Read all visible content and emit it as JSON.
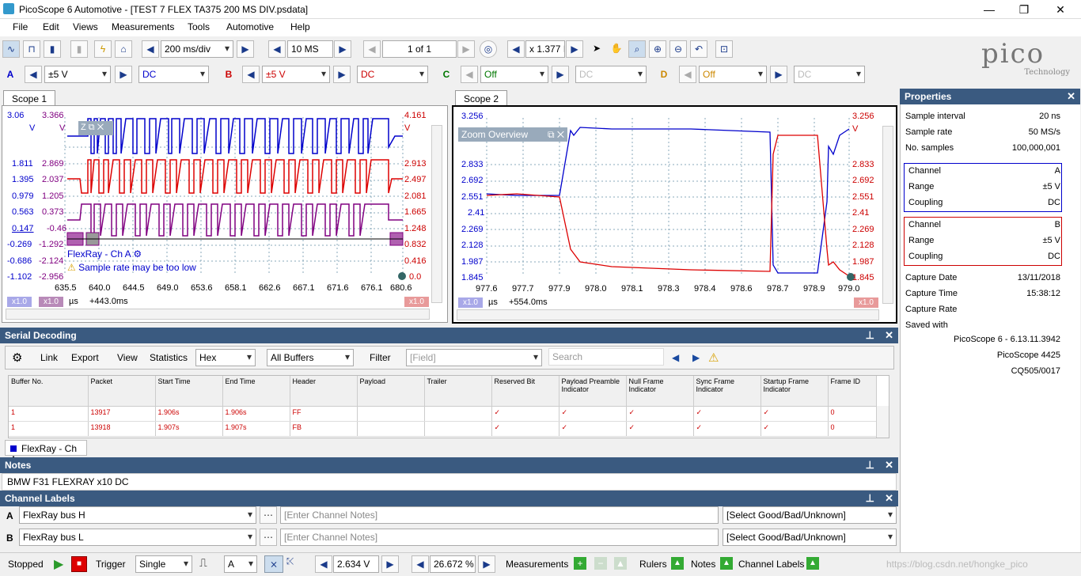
{
  "window": {
    "title": "PicoScope 6 Automotive - [TEST 7  FLEX TA375 200 MS DIV.psdata]",
    "min": "—",
    "max": "❐",
    "close": "✕"
  },
  "menu": [
    "File",
    "Edit",
    "Views",
    "Measurements",
    "Tools",
    "Automotive",
    "Help"
  ],
  "toolbar": {
    "timebase": "200 ms/div",
    "samples": "10 MS",
    "buffer": "1 of 1",
    "zoom": "x 1.377 I"
  },
  "channels": {
    "a": {
      "label": "A",
      "range": "±5 V",
      "coupling": "DC",
      "color": "#0000cc"
    },
    "b": {
      "label": "B",
      "range": "±5 V",
      "coupling": "DC",
      "color": "#cc0000"
    },
    "c": {
      "label": "C",
      "range": "Off",
      "coupling": "DC",
      "color": "#007700"
    },
    "d": {
      "label": "D",
      "range": "Off",
      "coupling": "DC",
      "color": "#cc8800"
    }
  },
  "logo": {
    "text": "pico",
    "sub": "Technology"
  },
  "scope1": {
    "tab": "Scope 1",
    "ylabels_a": [
      "3.06",
      "V",
      "1.811",
      "1.395",
      "0.979",
      "0.563",
      "0.147",
      "-0.269",
      "-0.686",
      "-1.102"
    ],
    "ylabels_c": [
      "3.366",
      "V",
      "2.869",
      "2.037",
      "1.205",
      "0.373",
      "-0.46",
      "-1.292",
      "-2.124",
      "-2.956"
    ],
    "ylabels_b": [
      "4.161",
      "V",
      "2.913",
      "2.497",
      "2.081",
      "1.665",
      "1.248",
      "0.832",
      "0.416",
      "0.0"
    ],
    "xlabels": [
      "635.5",
      "640.0",
      "644.5",
      "649.0",
      "653.6",
      "658.1",
      "662.6",
      "667.1",
      "671.6",
      "676.1",
      "680.6"
    ],
    "unit": "µs",
    "offset": "+443.0ms",
    "decoder_label": "FlexRay - Ch A",
    "warning": "Sample rate may be too low",
    "zoom_a": "x1.0",
    "zoom_c": "x1.0",
    "zoom_b": "x1.0",
    "zoom_box": "Z"
  },
  "scope2": {
    "tab": "Scope 2",
    "overview": "Zoom Overview",
    "ylabels_a": [
      "3.256",
      "2.833",
      "2.692",
      "2.551",
      "2.41",
      "2.269",
      "2.128",
      "1.987",
      "1.845"
    ],
    "ylabels_b": [
      "3.256",
      "V",
      "2.833",
      "2.692",
      "2.551",
      "2.41",
      "2.269",
      "2.128",
      "1.987",
      "1.845"
    ],
    "xlabels": [
      "977.6",
      "977.7",
      "977.9",
      "978.0",
      "978.1",
      "978.3",
      "978.4",
      "978.6",
      "978.7",
      "978.9",
      "979.0"
    ],
    "unit": "µs",
    "offset": "+554.0ms",
    "zoom_a": "x1.0",
    "zoom_b": "x1.0"
  },
  "properties": {
    "title": "Properties",
    "rows": [
      [
        "Sample interval",
        "20 ns"
      ],
      [
        "Sample rate",
        "50 MS/s"
      ],
      [
        "No. samples",
        "100,000,001"
      ]
    ],
    "chA": [
      [
        "Channel",
        "A"
      ],
      [
        "Range",
        "±5 V"
      ],
      [
        "Coupling",
        "DC"
      ]
    ],
    "chB": [
      [
        "Channel",
        "B"
      ],
      [
        "Range",
        "±5 V"
      ],
      [
        "Coupling",
        "DC"
      ]
    ],
    "capture": [
      [
        "Capture Date",
        "13/11/2018"
      ],
      [
        "Capture Time",
        "15:38:12"
      ],
      [
        "Capture Rate",
        ""
      ],
      [
        "Saved with",
        ""
      ]
    ],
    "saved": [
      "PicoScope 6 - 6.13.11.3942",
      "PicoScope 4425",
      "CQ505/0017"
    ]
  },
  "serial": {
    "title": "Serial Decoding",
    "link": "Link",
    "export": "Export",
    "view": "View",
    "statistics": "Statistics",
    "format": "Hex",
    "buffers": "All Buffers",
    "filter": "Filter",
    "field": "[Field]",
    "search": "Search",
    "columns": [
      "Buffer No.",
      "Packet",
      "Start Time",
      "End Time",
      "Header",
      "Payload",
      "Trailer",
      "Reserved Bit",
      "Payload Preamble Indicator",
      "Null Frame Indicator",
      "Sync Frame Indicator",
      "Startup Frame Indicator",
      "Frame ID"
    ],
    "rows": [
      [
        "1",
        "13917",
        "1.906s",
        "1.906s",
        "FF",
        "",
        "",
        "✓",
        "✓",
        "✓",
        "✓",
        "✓",
        "0"
      ],
      [
        "1",
        "13918",
        "1.907s",
        "1.907s",
        "FB",
        "",
        "",
        "✓",
        "✓",
        "✓",
        "✓",
        "✓",
        "0"
      ]
    ],
    "tab": "FlexRay - Ch A"
  },
  "notes": {
    "title": "Notes",
    "text": "BMW F31 FLEXRAY x10 DC"
  },
  "labels": {
    "title": "Channel Labels",
    "rows": [
      {
        "ch": "A",
        "name": "FlexRay bus H",
        "notes": "[Enter Channel Notes]",
        "status": "[Select Good/Bad/Unknown]"
      },
      {
        "ch": "B",
        "name": "FlexRay bus L",
        "notes": "[Enter Channel Notes]",
        "status": "[Select Good/Bad/Unknown]"
      }
    ]
  },
  "status": {
    "state": "Stopped",
    "trigger": "Trigger",
    "mode": "Single",
    "source": "A",
    "level": "2.634 V",
    "pre": "26.672 %",
    "measurements": "Measurements",
    "rulers": "Rulers",
    "notes": "Notes",
    "chlabels": "Channel Labels",
    "watermark": "https://blog.csdn.net/hongke_pico"
  }
}
